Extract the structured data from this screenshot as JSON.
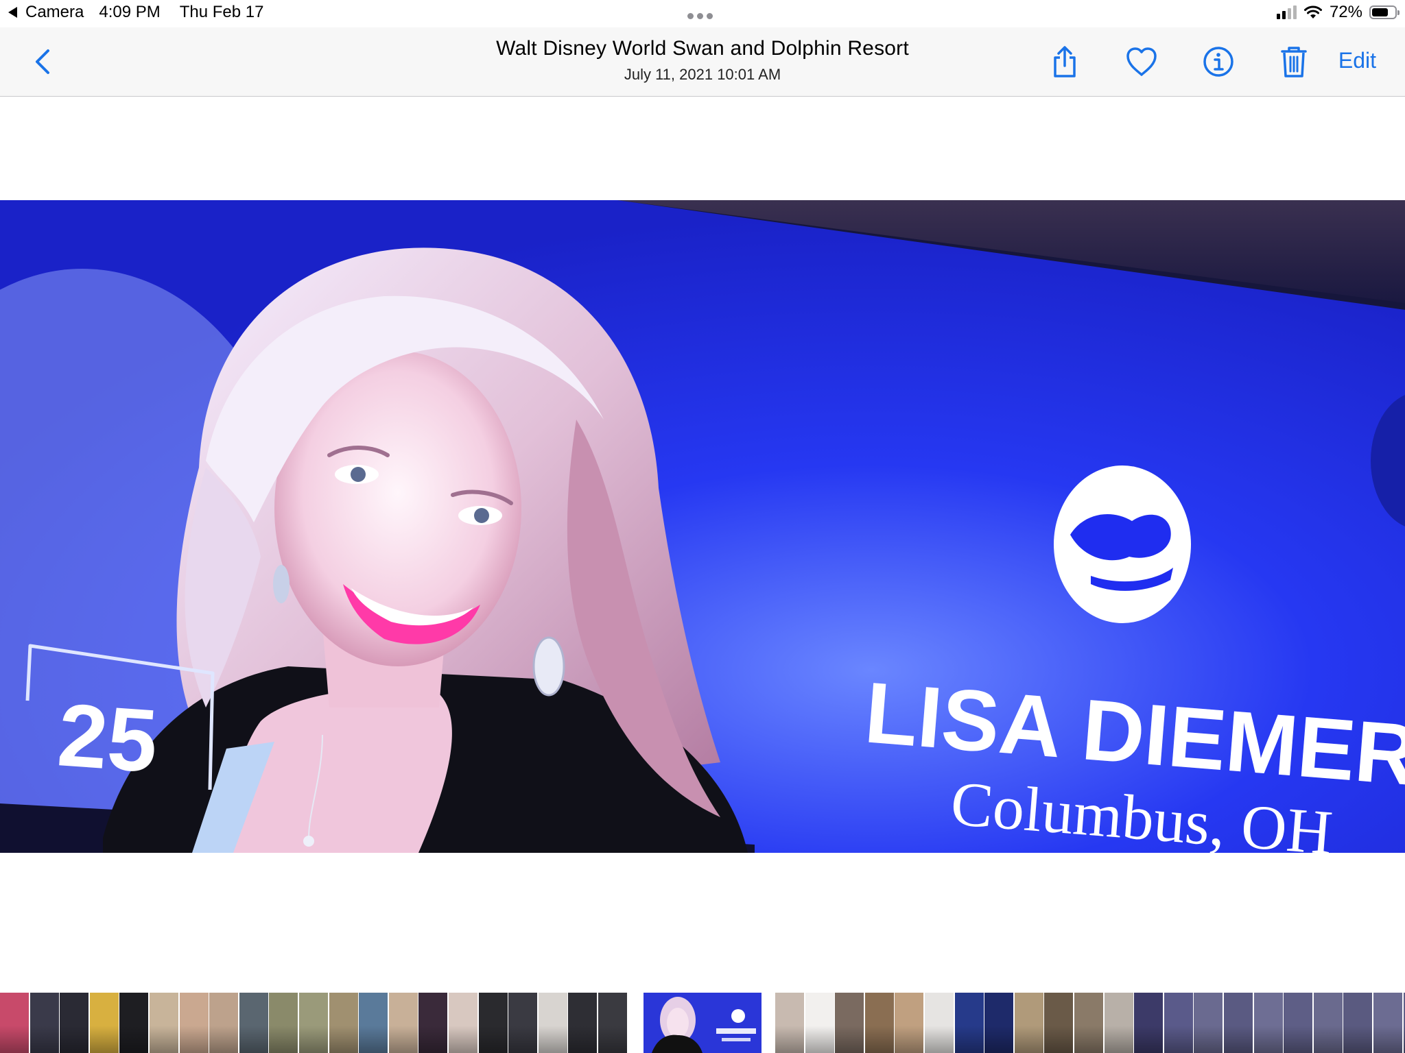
{
  "status_bar": {
    "back_app": "Camera",
    "time": "4:09 PM",
    "date": "Thu Feb 17",
    "battery": "72%",
    "battery_level": 0.72
  },
  "nav": {
    "title": "Walt Disney World Swan and Dolphin Resort",
    "subtitle": "July 11, 2021  10:01 AM",
    "edit_label": "Edit",
    "icons": [
      "back-chevron-icon",
      "share-icon",
      "heart-icon",
      "info-icon",
      "trash-icon"
    ],
    "accent_color": "#1a73e8"
  },
  "photo": {
    "badge_number": "25",
    "name": "LISA DIEMER",
    "location": "Columbus, OH",
    "screen_color": "#1f2df0"
  },
  "filmstrip": {
    "thumbnail_colors": [
      "#c84a6a",
      "#3a3a4a",
      "#2a2a34",
      "#d8b040",
      "#1e1e22",
      "#c8b49a",
      "#caa890",
      "#bda28c",
      "#5a6670",
      "#8a8a6a",
      "#9a9a7a",
      "#a09070",
      "#5a7a9a",
      "#c8b098",
      "#3a2a3a",
      "#d8c8c0",
      "#2a2a2e",
      "#3a3a42",
      "#d8d4d0",
      "#2e2e34",
      "#3a3a40",
      "#c8bab0",
      "#f2f0ee",
      "#7a6a60",
      "#8a6e52",
      "#c0a080",
      "#e6e4e2",
      "#263a8a",
      "#1e2a6a",
      "#b09a7a",
      "#6a5a48",
      "#8a7a68",
      "#b8b0a8",
      "#3c3a68",
      "#5a5a8a",
      "#6a6a90",
      "#5a5a82",
      "#6e6e94",
      "#5e5e86",
      "#6a6a8e",
      "#5a5a80",
      "#6c6c92",
      "#606088",
      "#686890",
      "#5c5c84",
      "#6a6a8c",
      "#5e5e88",
      "#66668e",
      "#5a5a84",
      "#6c6c90",
      "#626288"
    ]
  }
}
